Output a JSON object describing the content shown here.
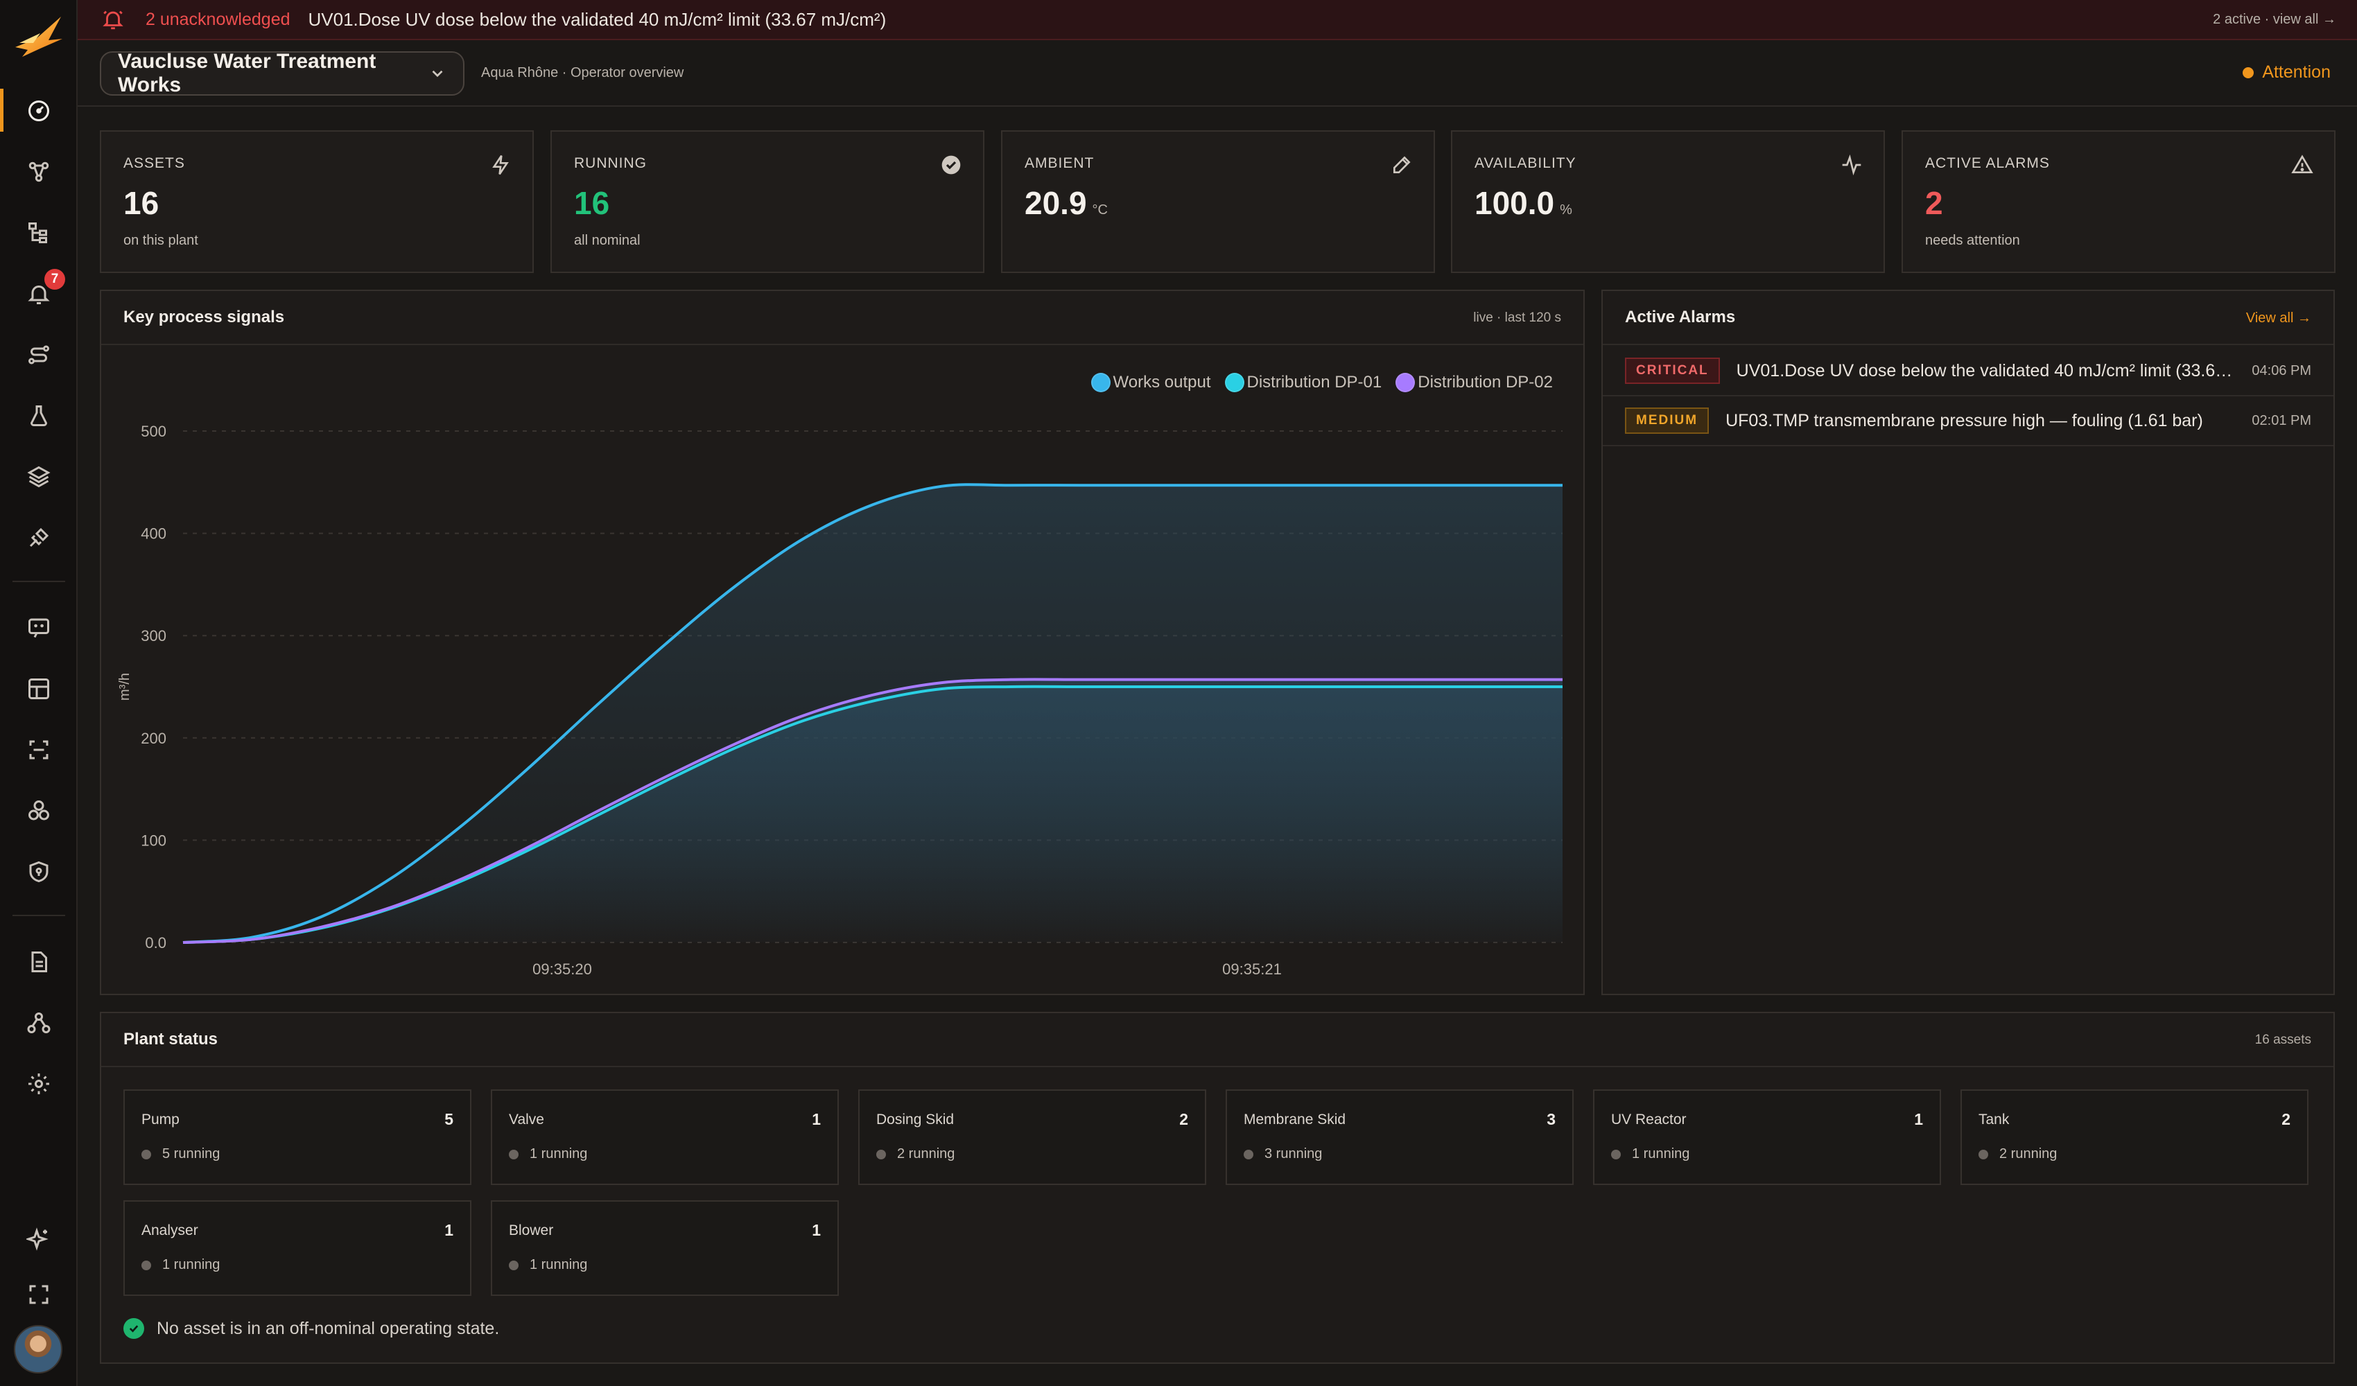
{
  "banner": {
    "unack": "2 unacknowledged",
    "message": "UV01.Dose UV dose below the validated 40 mJ/cm² limit (33.67 mJ/cm²)",
    "summary": "2 active · view all →"
  },
  "header": {
    "plant": "Vaucluse Water Treatment Works",
    "subtitle": "Aqua Rhône · Operator overview",
    "status": "Attention"
  },
  "sidebar": {
    "notification_count": "7",
    "items": [
      "overview-icon",
      "topology-icon",
      "hierarchy-icon",
      "alarms-icon",
      "routes-icon",
      "lab-icon",
      "layers-icon",
      "integrations-icon",
      "chat-icon",
      "grid-icon",
      "scan-icon",
      "modules-icon",
      "security-icon",
      "reports-icon",
      "org-icon",
      "settings-icon",
      "assistant-icon",
      "fullscreen-icon"
    ]
  },
  "kpis": [
    {
      "label": "ASSETS",
      "value": "16",
      "unit": "",
      "sub": "on this plant",
      "icon": "bolt-icon",
      "color": "#f5f1ec"
    },
    {
      "label": "RUNNING",
      "value": "16",
      "unit": "",
      "sub": "all nominal",
      "icon": "check-circle-icon",
      "color": "#22c27a"
    },
    {
      "label": "AMBIENT",
      "value": "20.9",
      "unit": "°C",
      "sub": "",
      "icon": "pencil-icon",
      "color": "#f5f1ec"
    },
    {
      "label": "AVAILABILITY",
      "value": "100.0",
      "unit": "%",
      "sub": "",
      "icon": "pulse-icon",
      "color": "#f5f1ec"
    },
    {
      "label": "ACTIVE ALARMS",
      "value": "2",
      "unit": "",
      "sub": "needs attention",
      "icon": "warning-icon",
      "color": "#ef5a5a"
    }
  ],
  "signals": {
    "title": "Key process signals",
    "meta": "live · last 120 s"
  },
  "chart_data": {
    "type": "line",
    "title": "Key process signals",
    "ylabel": "m³/h",
    "xlabel": "",
    "ylim": [
      0,
      500
    ],
    "yticks": [
      "0.0",
      "100",
      "200",
      "300",
      "400",
      "500"
    ],
    "xtick_labels": [
      "09:35:20",
      "09:35:21"
    ],
    "x": [
      0,
      1,
      2,
      3,
      4,
      5,
      6,
      7,
      8,
      9,
      10,
      11,
      12,
      13,
      14,
      15,
      16,
      17,
      18,
      19,
      20
    ],
    "series": [
      {
        "name": "Works output",
        "color": "#38b6ec",
        "values": [
          0,
          5,
          25,
          62,
          112,
          170,
          232,
          292,
          348,
          395,
          428,
          446,
          447,
          447,
          447,
          447,
          447,
          447,
          447,
          447,
          447
        ]
      },
      {
        "name": "Distribution DP-01",
        "color": "#2ad0e4",
        "values": [
          0,
          3,
          14,
          33,
          59,
          90,
          124,
          158,
          190,
          217,
          236,
          248,
          250,
          250,
          250,
          250,
          250,
          250,
          250,
          250,
          250
        ]
      },
      {
        "name": "Distribution DP-02",
        "color": "#a77bff",
        "values": [
          0,
          3,
          15,
          34,
          61,
          93,
          128,
          162,
          194,
          222,
          242,
          254,
          257,
          257,
          257,
          257,
          257,
          257,
          257,
          257,
          257
        ]
      }
    ],
    "grid": true,
    "legend": "top-right"
  },
  "alarms": {
    "title": "Active Alarms",
    "view_all": "View all →",
    "rows": [
      {
        "severity": "CRITICAL",
        "text": "UV01.Dose UV dose below the validated 40 mJ/cm² limit (33.67 mJ/cm²)",
        "time": "04:06 PM"
      },
      {
        "severity": "MEDIUM",
        "text": "UF03.TMP transmembrane pressure high — fouling (1.61 bar)",
        "time": "02:01 PM"
      }
    ]
  },
  "plant_status": {
    "title": "Plant status",
    "meta": "16 assets",
    "assets": [
      {
        "name": "Pump",
        "count": "5",
        "state": "5 running"
      },
      {
        "name": "Valve",
        "count": "1",
        "state": "1 running"
      },
      {
        "name": "Dosing Skid",
        "count": "2",
        "state": "2 running"
      },
      {
        "name": "Membrane Skid",
        "count": "3",
        "state": "3 running"
      },
      {
        "name": "UV Reactor",
        "count": "1",
        "state": "1 running"
      },
      {
        "name": "Tank",
        "count": "2",
        "state": "2 running"
      },
      {
        "name": "Analyser",
        "count": "1",
        "state": "1 running"
      },
      {
        "name": "Blower",
        "count": "1",
        "state": "1 running"
      }
    ],
    "nominal_message": "No asset is in an off-nominal operating state."
  }
}
